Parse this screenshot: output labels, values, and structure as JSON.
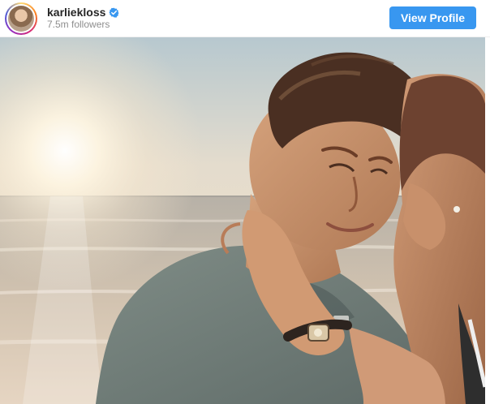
{
  "profile": {
    "username": "karliekloss",
    "followers": "7.5m followers",
    "verified_icon": "verified-badge-icon",
    "avatar_icon": "profile-avatar"
  },
  "actions": {
    "view_profile_label": "View Profile"
  },
  "colors": {
    "button": "#3897f0",
    "username": "#262626",
    "followers": "#8e8e8e",
    "verified": "#3897f0"
  },
  "post": {
    "image_icon": "post-photo"
  }
}
